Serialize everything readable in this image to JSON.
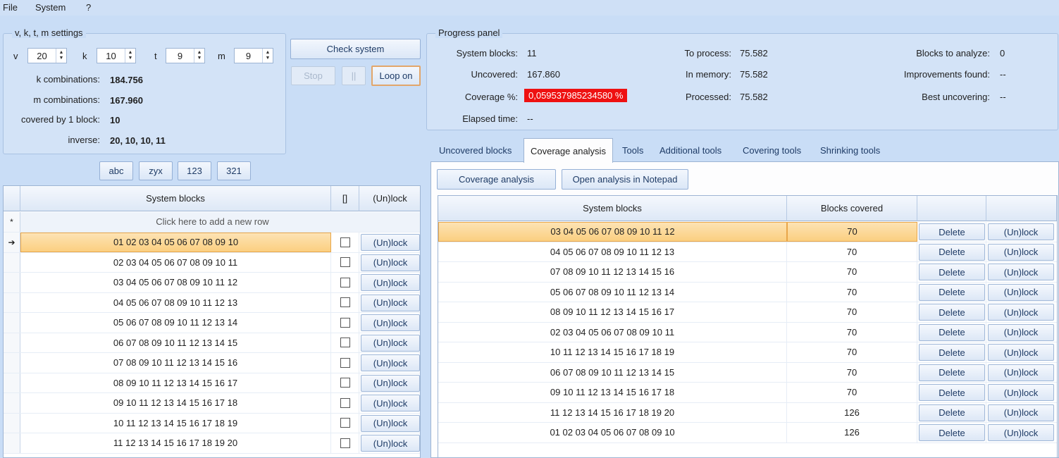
{
  "menu": {
    "items": [
      "File",
      "System",
      "?"
    ]
  },
  "settings": {
    "title": "v, k, t, m settings",
    "v_label": "v",
    "v_value": "20",
    "k_label": "k",
    "k_value": "10",
    "t_label": "t",
    "t_value": "9",
    "m_label": "m",
    "m_value": "9",
    "k_comb_label": "k combinations:",
    "k_comb_value": "184.756",
    "m_comb_label": "m combinations:",
    "m_comb_value": "167.960",
    "covered_label": "covered by 1 block:",
    "covered_value": "10",
    "inverse_label": "inverse:",
    "inverse_value": "20, 10, 10, 11"
  },
  "actions": {
    "check_system": "Check system",
    "stop": "Stop",
    "pause": "||",
    "loop": "Loop on"
  },
  "sort_buttons": [
    "abc",
    "zyx",
    "123",
    "321"
  ],
  "progress": {
    "title": "Progress panel",
    "system_blocks_label": "System blocks:",
    "system_blocks_value": "11",
    "uncovered_label": "Uncovered:",
    "uncovered_value": "167.860",
    "coverage_label": "Coverage %:",
    "coverage_value": "0,059537985234580 %",
    "elapsed_label": "Elapsed time:",
    "elapsed_value": "--",
    "to_process_label": "To process:",
    "to_process_value": "75.582",
    "in_memory_label": "In memory:",
    "in_memory_value": "75.582",
    "processed_label": "Processed:",
    "processed_value": "75.582",
    "blocks_analyze_label": "Blocks to analyze:",
    "blocks_analyze_value": "0",
    "improvements_label": "Improvements found:",
    "improvements_value": "--",
    "best_label": "Best uncovering:",
    "best_value": "--",
    "accent_red": "#ee1111"
  },
  "tabs": [
    "Uncovered blocks",
    "Coverage analysis",
    "Tools",
    "Additional tools",
    "Covering tools",
    "Shrinking tools"
  ],
  "active_tab": "Coverage analysis",
  "left_grid": {
    "headers": [
      "System blocks",
      "[]",
      "(Un)lock"
    ],
    "new_row_marker": "*",
    "new_row_text": "Click here to add a new row",
    "current_row_marker": "➔",
    "lock_label": "(Un)lock",
    "rows": [
      "01 02 03 04 05 06 07 08 09 10",
      "02 03 04 05 06 07 08 09 10 11",
      "03 04 05 06 07 08 09 10 11 12",
      "04 05 06 07 08 09 10 11 12 13",
      "05 06 07 08 09 10 11 12 13 14",
      "06 07 08 09 10 11 12 13 14 15",
      "07 08 09 10 11 12 13 14 15 16",
      "08 09 10 11 12 13 14 15 16 17",
      "09 10 11 12 13 14 15 16 17 18",
      "10 11 12 13 14 15 16 17 18 19",
      "11 12 13 14 15 16 17 18 19 20"
    ]
  },
  "analysis": {
    "coverage_button": "Coverage analysis",
    "notepad_button": "Open analysis in Notepad",
    "headers": [
      "System blocks",
      "Blocks covered",
      "",
      ""
    ],
    "delete_label": "Delete",
    "lock_label": "(Un)lock",
    "rows": [
      {
        "block": "03 04 05 06 07 08 09 10 11 12",
        "covered": "70"
      },
      {
        "block": "04 05 06 07 08 09 10 11 12 13",
        "covered": "70"
      },
      {
        "block": "07 08 09 10 11 12 13 14 15 16",
        "covered": "70"
      },
      {
        "block": "05 06 07 08 09 10 11 12 13 14",
        "covered": "70"
      },
      {
        "block": "08 09 10 11 12 13 14 15 16 17",
        "covered": "70"
      },
      {
        "block": "02 03 04 05 06 07 08 09 10 11",
        "covered": "70"
      },
      {
        "block": "10 11 12 13 14 15 16 17 18 19",
        "covered": "70"
      },
      {
        "block": "06 07 08 09 10 11 12 13 14 15",
        "covered": "70"
      },
      {
        "block": "09 10 11 12 13 14 15 16 17 18",
        "covered": "70"
      },
      {
        "block": "11 12 13 14 15 16 17 18 19 20",
        "covered": "126"
      },
      {
        "block": "01 02 03 04 05 06 07 08 09 10",
        "covered": "126"
      }
    ]
  }
}
